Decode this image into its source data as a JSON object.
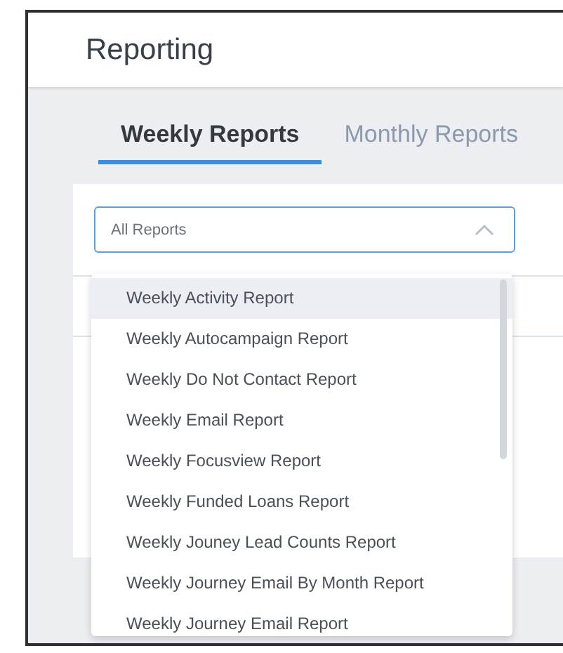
{
  "page": {
    "title": "Reporting"
  },
  "tabs": [
    {
      "label": "Weekly Reports",
      "selected": true
    },
    {
      "label": "Monthly Reports",
      "selected": false
    }
  ],
  "report_select": {
    "placeholder": "All Reports",
    "expanded": true
  },
  "dropdown_options": [
    {
      "label": "Weekly Activity Report",
      "selected": true
    },
    {
      "label": "Weekly Autocampaign Report",
      "selected": false
    },
    {
      "label": "Weekly Do Not Contact Report",
      "selected": false
    },
    {
      "label": "Weekly Email Report",
      "selected": false
    },
    {
      "label": "Weekly Focusview Report",
      "selected": false
    },
    {
      "label": "Weekly Funded Loans Report",
      "selected": false
    },
    {
      "label": "Weekly Jouney Lead Counts Report",
      "selected": false
    },
    {
      "label": "Weekly Journey Email By Month Report",
      "selected": false
    },
    {
      "label": "Weekly Journey Email Report",
      "selected": false
    }
  ]
}
